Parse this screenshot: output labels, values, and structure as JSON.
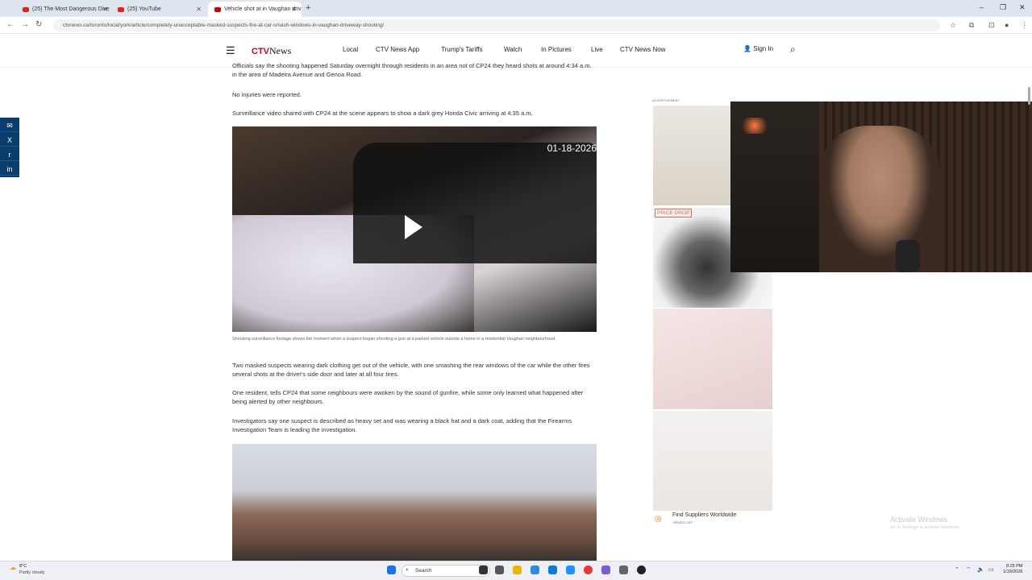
{
  "browser": {
    "tabs": [
      {
        "title": "(25) The Most Dangerous Dive"
      },
      {
        "title": "(25) YouTube"
      },
      {
        "title": "Vehicle shot at in Vaughan driv"
      }
    ],
    "new_tab": "+",
    "url": "ctvnews.ca/toronto/local/york/article/completely-unacceptable-masked-suspects-fire-at-car-smash-windows-in-vaughan-driveway-shooting/",
    "window_controls": {
      "minimize": "–",
      "maximize": "❐",
      "close": "✕"
    }
  },
  "site": {
    "logo_prefix": "CTV",
    "logo_suffix": "News",
    "nav": [
      "Local",
      "CTV News App",
      "Trump's Tariffs",
      "Watch",
      "In Pictures",
      "Live",
      "CTV News Now"
    ],
    "signin": "Sign In"
  },
  "share": [
    "✉",
    "X",
    "r",
    "in"
  ],
  "article": {
    "para0": "Officials say the shooting happened Saturday overnight through residents in an area not of CP24 they heard shots at around 4:34 a.m. in the area of Madeira Avenue and Genoa Road.",
    "para1": "No injuries were reported.",
    "para2": "Surveillance video shared with CP24 at the scene appears to show a dark grey Honda Civic arriving at 4:35 a.m.",
    "video_timestamp": "01-18-2026",
    "caption": "Shocking surveillance footage shows the moment when a suspect began shooting a gun at a parked vehicle outside a home in a residential Vaughan neighbourhood.",
    "para3": "Two masked suspects wearing dark clothing get out of the vehicle, with one smashing the rear windows of the car while the other fires several shots at the driver's side door and later at all four tires.",
    "para4": "One resident, tells CP24 that some neighbours were awoken by the sound of gunfire, while some only learned what happened after being alerted by other neighbours.",
    "para5": "Investigators say one suspect is described as heavy set and was wearing a black hat and a dark coat, adding that the Firearms Investigation Team is leading the investigation."
  },
  "ads": {
    "label": "ADVERTISEMENT",
    "price_drop": "PRICE DROP",
    "footer_title": "Find Suppliers Worldwide",
    "footer_source": "Alibaba.com"
  },
  "overlay": {
    "activate_title": "Activate Windows",
    "activate_sub": "Go to Settings to activate Windows."
  },
  "taskbar": {
    "weather_temp": "8°C",
    "weather_desc": "Partly cloudy",
    "search_placeholder": "Search",
    "time": "8:25 PM",
    "date": "1/19/2026"
  }
}
